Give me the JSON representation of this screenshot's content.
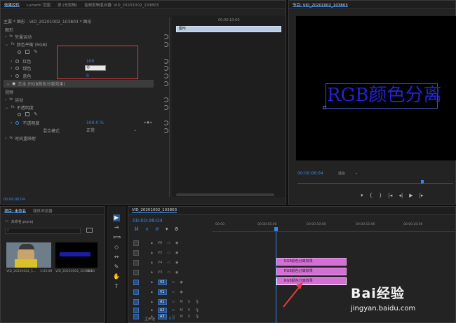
{
  "effect_panel": {
    "tabs": [
      "效果控件",
      "Lumetri 范围",
      "源:(无剪辑)",
      "音频剪辑混合器: VID_20201002_103803"
    ],
    "clip_path": "主要 * 图形 - VID_20201002_103803 * 图形",
    "timeline_time": "00:00:10:00",
    "strip_label": "图形",
    "rows": [
      {
        "label": "图形"
      },
      {
        "label": "矢量运动"
      },
      {
        "label": "颜色平衡 (RGB)"
      },
      {
        "label": "红色",
        "value": "100"
      },
      {
        "label": "绿色",
        "value": "0"
      },
      {
        "label": "蓝色",
        "value": "0"
      },
      {
        "label": "文本 (RGB颜色分离效果)"
      },
      {
        "label": "视频"
      },
      {
        "label": "运动"
      },
      {
        "label": "不透明度"
      },
      {
        "label": "不透明度",
        "value": "100.0 %"
      },
      {
        "label": "混合模式",
        "value": "正常"
      },
      {
        "label": "时间重映射"
      }
    ],
    "footer_time": "00:00:06:04"
  },
  "program": {
    "title": "节目: VID_20201002_103803",
    "caption": "RGB颜色分离",
    "timecode": "00:00:06:04",
    "fit": "适合"
  },
  "project": {
    "tabs": [
      "项目: 未命名",
      "媒体浏览器"
    ],
    "file": "未命名.prproj",
    "items": [
      {
        "name": "VID_20201002_1...",
        "duration": "1:03:08"
      },
      {
        "name": "VID_20201002_103803",
        "duration": "6:04"
      }
    ]
  },
  "timeline": {
    "title": "VID_20201002_103803",
    "timecode": "00:00:06:04",
    "ruler": [
      "00:00",
      "00:00:05:00",
      "00:00:10:00",
      "00:00:15:00",
      "00:00:20:00"
    ],
    "video_tracks": [
      "V6",
      "V5",
      "V4",
      "V3",
      "V2",
      "V1"
    ],
    "audio_tracks": [
      "A1",
      "A2",
      "A3"
    ],
    "master_label": "主声道",
    "master_value": "0.0",
    "clip_label": "RGB颜色分离效果",
    "watermark_brand": "Bai经验",
    "watermark_url": "jingyan.baidu.com"
  },
  "colors": {
    "accent_blue": "#3a86e8",
    "clip_pink": "#d56ed6",
    "annotation_red": "#e53b3b",
    "text_blue": "#2323d6"
  }
}
